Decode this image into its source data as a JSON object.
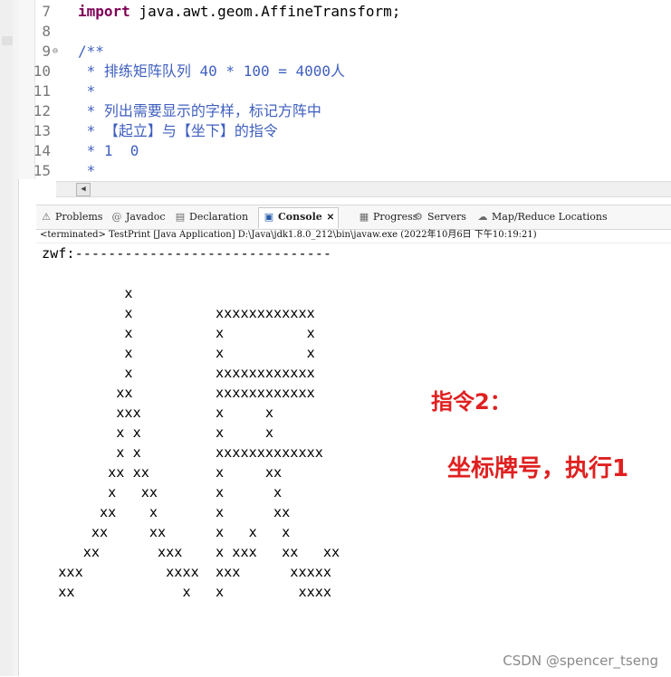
{
  "editor": {
    "lines": [
      {
        "num": "7",
        "fold": "",
        "kw": "import",
        "text": " java.awt.geom.AffineTransform;",
        "style": "code"
      },
      {
        "num": "8",
        "fold": "",
        "kw": "",
        "text": "",
        "style": "code"
      },
      {
        "num": "9",
        "fold": "⊖",
        "kw": "",
        "text": "/**",
        "style": "comment"
      },
      {
        "num": "10",
        "fold": "",
        "kw": "",
        "text": " * 排练矩阵队列 40 * 100 = 4000人",
        "style": "comment"
      },
      {
        "num": "11",
        "fold": "",
        "kw": "",
        "text": " *",
        "style": "comment"
      },
      {
        "num": "12",
        "fold": "",
        "kw": "",
        "text": " * 列出需要显示的字样，标记方阵中",
        "style": "comment"
      },
      {
        "num": "13",
        "fold": "",
        "kw": "",
        "text": " * 【起立】与【坐下】的指令",
        "style": "comment"
      },
      {
        "num": "14",
        "fold": "",
        "kw": "",
        "text": " * 1  0",
        "style": "comment"
      },
      {
        "num": "15",
        "fold": "",
        "kw": "",
        "text": " *",
        "style": "comment"
      }
    ]
  },
  "tabs": [
    {
      "label": "Problems",
      "icon": "problems-icon",
      "glyph": "⚠"
    },
    {
      "label": "Javadoc",
      "icon": "javadoc-icon",
      "glyph": "@"
    },
    {
      "label": "Declaration",
      "icon": "declaration-icon",
      "glyph": "▤"
    },
    {
      "label": "Console",
      "icon": "console-icon",
      "glyph": "▣",
      "active": true,
      "close": "✕"
    },
    {
      "label": "Progress",
      "icon": "progress-icon",
      "glyph": "▦"
    },
    {
      "label": "Servers",
      "icon": "servers-icon",
      "glyph": "⚙"
    },
    {
      "label": "Map/Reduce Locations",
      "icon": "mapreduce-icon",
      "glyph": "☁"
    }
  ],
  "console": {
    "status": "<terminated> TestPrint [Java Application] D:\\Java\\jdk1.8.0_212\\bin\\javaw.exe (2022年10月6日 下午10:19:21)",
    "output": "zwf:-------------------------------\n\n          x\n          x          xxxxxxxxxxxx\n          x          x          x\n          x          x          x\n          x          xxxxxxxxxxxx\n         xx          xxxxxxxxxxxx\n         xxx         x     x\n         x x         x     x\n         x x         xxxxxxxxxxxxx\n        xx xx        x     xx\n        x   xx       x      x\n       xx    x       x      xx\n      xx     xx      x   x   x\n     xx       xxx    x xxx   xx   xx\n  xxx          xxxx  xxx      xxxxx\n  xx             x   x         xxxx"
  },
  "annotations": {
    "line1": "指令2：",
    "line2": "坐标牌号，执行1"
  },
  "watermark": "CSDN @spencer_tseng"
}
